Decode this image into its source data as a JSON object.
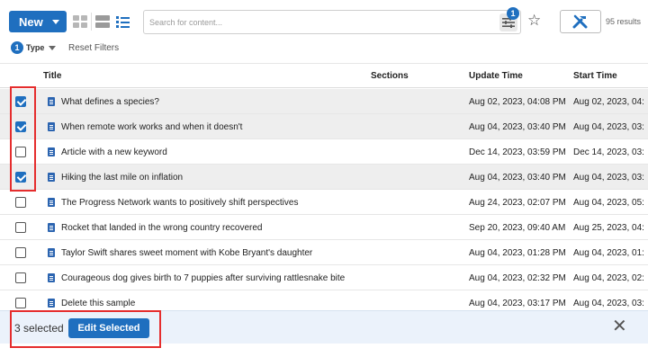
{
  "toolbar": {
    "new_label": "New",
    "search_placeholder": "Search for content...",
    "filter_badge": "1",
    "results_text": "95 results",
    "icons": [
      "grid-view-icon",
      "rows-view-icon",
      "list-view-icon",
      "filter-icon",
      "star-icon",
      "tools-icon"
    ]
  },
  "filters": {
    "type_count": "1",
    "type_label": "Type",
    "reset_label": "Reset Filters"
  },
  "table": {
    "columns": [
      "Title",
      "Sections",
      "Update Time",
      "Start Time"
    ],
    "rows": [
      {
        "selected": true,
        "title": "What defines a species?",
        "update": "Aug 02, 2023, 04:08 PM",
        "start": "Aug 02, 2023, 04:"
      },
      {
        "selected": true,
        "title": "When remote work works and when it doesn't",
        "update": "Aug 04, 2023, 03:40 PM",
        "start": "Aug 04, 2023, 03:"
      },
      {
        "selected": false,
        "title": "Article with a new keyword",
        "update": "Dec 14, 2023, 03:59 PM",
        "start": "Dec 14, 2023, 03:"
      },
      {
        "selected": true,
        "title": "Hiking the last mile on inflation",
        "update": "Aug 04, 2023, 03:40 PM",
        "start": "Aug 04, 2023, 03:"
      },
      {
        "selected": false,
        "title": "The Progress Network wants to positively shift perspectives",
        "update": "Aug 24, 2023, 02:07 PM",
        "start": "Aug 04, 2023, 05:"
      },
      {
        "selected": false,
        "title": "Rocket that landed in the wrong country recovered",
        "update": "Sep 20, 2023, 09:40 AM",
        "start": "Aug 25, 2023, 04:"
      },
      {
        "selected": false,
        "title": "Taylor Swift shares sweet moment with Kobe Bryant's daughter",
        "update": "Aug 04, 2023, 01:28 PM",
        "start": "Aug 04, 2023, 01:"
      },
      {
        "selected": false,
        "title": "Courageous dog gives birth to 7 puppies after surviving rattlesnake bite",
        "update": "Aug 04, 2023, 02:32 PM",
        "start": "Aug 04, 2023, 02:"
      },
      {
        "selected": false,
        "title": "Delete this sample",
        "update": "Aug 04, 2023, 03:17 PM",
        "start": "Aug 04, 2023, 03:"
      }
    ]
  },
  "footer": {
    "selected_text": "3 selected",
    "edit_label": "Edit Selected"
  },
  "colors": {
    "accent": "#1f6fbf",
    "selected_row": "#eeeeee",
    "footer_bg": "#ebf2fb",
    "annotation": "#e52d2d"
  }
}
